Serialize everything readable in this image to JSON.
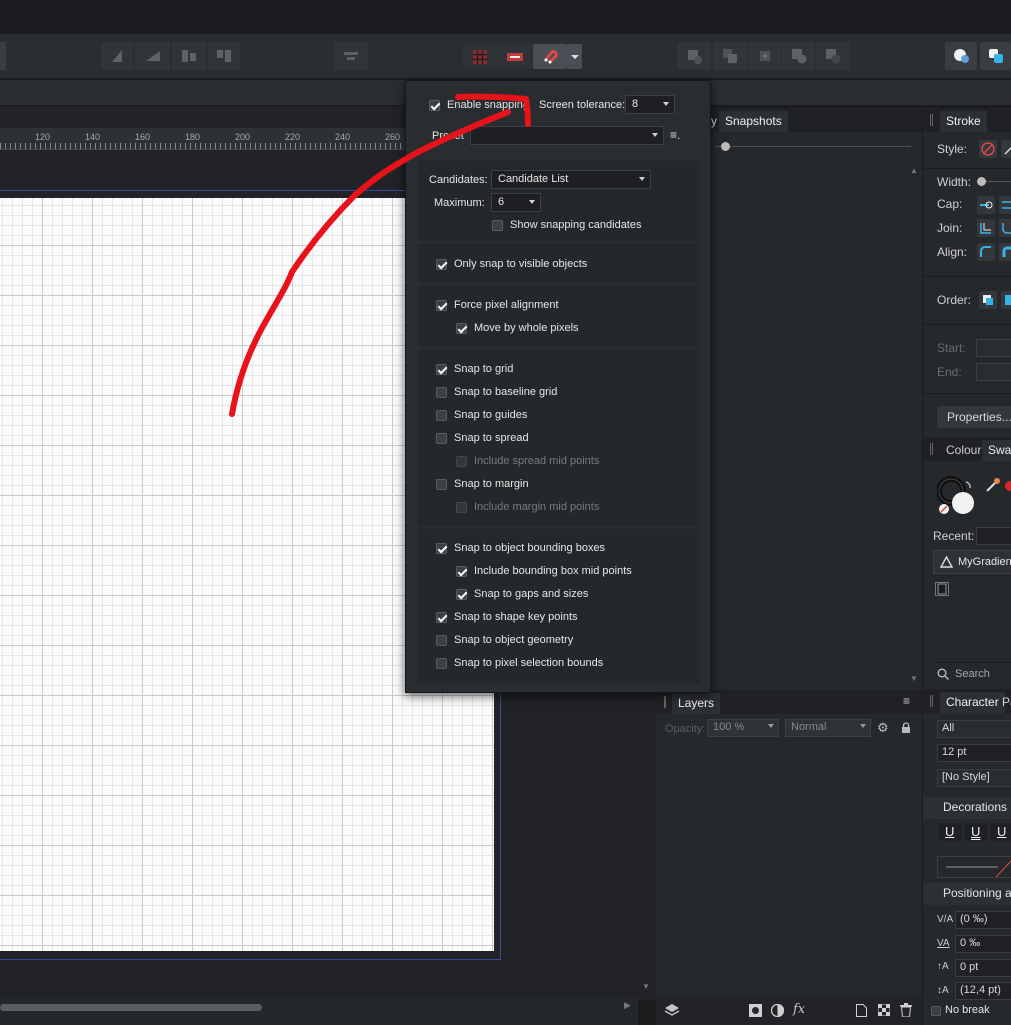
{
  "toolbar": {
    "snapping_button": "snapping-magnet",
    "snapping_dropdown": "chevron-down"
  },
  "ruler": {
    "labels": [
      "120",
      "140",
      "160",
      "180",
      "200",
      "220",
      "240",
      "260"
    ]
  },
  "history_panel": {
    "tabs": [
      "y",
      "Snapshots"
    ]
  },
  "snapping": {
    "enable_label": "Enable snapping",
    "enable_checked": true,
    "tolerance_label": "Screen tolerance:",
    "tolerance_value": "8",
    "preset_label": "Preset",
    "preset_value": "",
    "candidates_label": "Candidates:",
    "candidates_value": "Candidate List",
    "maximum_label": "Maximum:",
    "maximum_value": "6",
    "show_candidates_label": "Show snapping candidates",
    "show_candidates_checked": false,
    "visible_only_label": "Only snap to visible objects",
    "visible_only_checked": true,
    "force_pixel_label": "Force pixel alignment",
    "force_pixel_checked": true,
    "whole_pixels_label": "Move by whole pixels",
    "whole_pixels_checked": true,
    "grid_label": "Snap to grid",
    "grid_checked": true,
    "baseline_label": "Snap to baseline grid",
    "guides_label": "Snap to guides",
    "spread_label": "Snap to spread",
    "spread_mid_label": "Include spread mid points",
    "margin_label": "Snap to margin",
    "margin_mid_label": "Include margin mid points",
    "bbox_label": "Snap to object bounding boxes",
    "bbox_checked": true,
    "bbox_mid_label": "Include bounding box mid points",
    "bbox_mid_checked": true,
    "gaps_label": "Snap to gaps and sizes",
    "gaps_checked": true,
    "key_points_label": "Snap to shape key points",
    "key_points_checked": true,
    "geometry_label": "Snap to object geometry",
    "pixel_sel_label": "Snap to pixel selection bounds"
  },
  "layers": {
    "tab": "Layers",
    "opacity_label": "Opacity:",
    "opacity_value": "100 %",
    "blend_value": "Normal"
  },
  "stroke": {
    "tab": "Stroke",
    "style_label": "Style:",
    "width_label": "Width:",
    "cap_label": "Cap:",
    "join_label": "Join:",
    "align_label": "Align:",
    "order_label": "Order:",
    "start_label": "Start:",
    "end_label": "End:",
    "properties_button": "Properties..."
  },
  "colour": {
    "tabs": [
      "Colour",
      "Swat"
    ],
    "recent_label": "Recent:",
    "gradient_name": "MyGradien",
    "search_placeholder": "Search"
  },
  "character": {
    "tabs": [
      "Character",
      "Pa"
    ],
    "font_value": "All",
    "size_value": "12 pt",
    "style_value": "[No Style]",
    "decorations_label": "Decorations",
    "positioning_label": "Positioning a",
    "tracking_value": "(0 ‰)",
    "kerning_value": "0 ‰",
    "baseline_value": "0 pt",
    "leading_value": "(12,4 pt)",
    "no_break_label": "No break"
  },
  "annotation_color": "#e8121a"
}
